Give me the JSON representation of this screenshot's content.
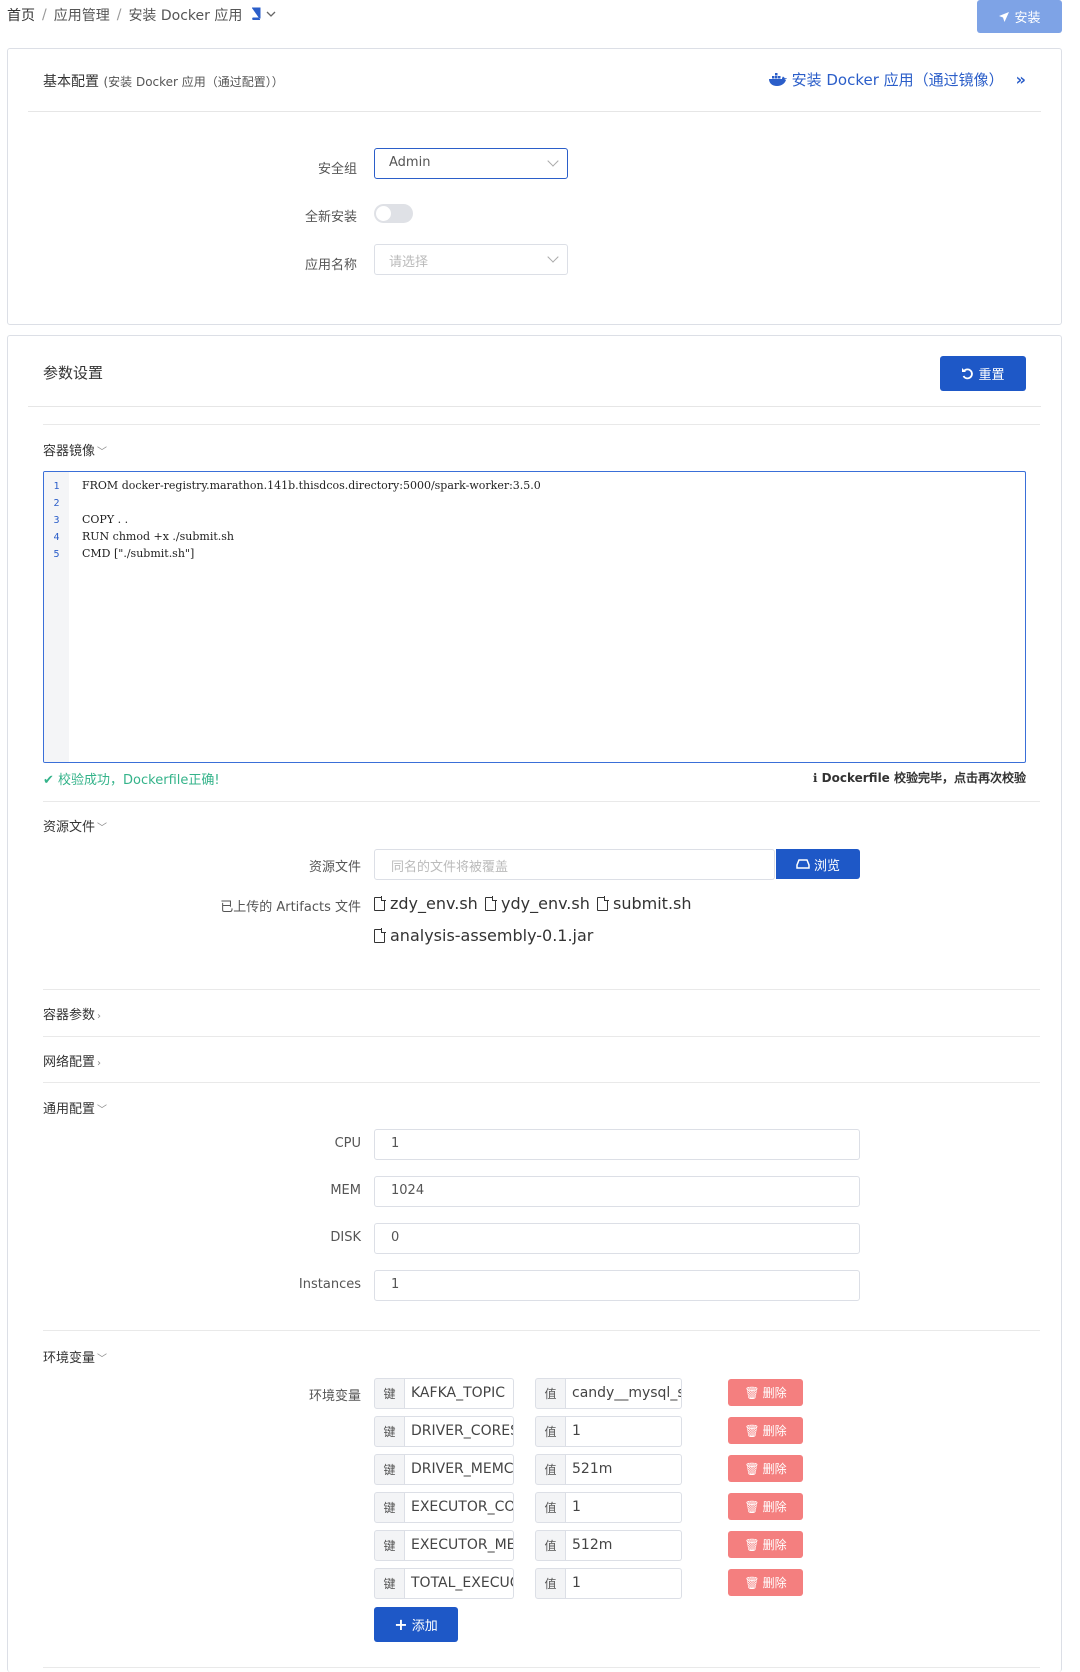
{
  "breadcrumb": {
    "home": "首页",
    "sep": "/",
    "app_mgmt": "应用管理",
    "current": "安装 Docker 应用"
  },
  "toolbar": {
    "install_label": "安装"
  },
  "basic": {
    "title": "基本配置",
    "subtitle": "(安装 Docker 应用（通过配置））",
    "switch_link": "安装 Docker 应用（通过镜像）",
    "security_group_label": "安全组",
    "security_group_value": "Admin",
    "fresh_install_label": "全新安装",
    "app_name_label": "应用名称",
    "app_name_placeholder": "请选择"
  },
  "params": {
    "title": "参数设置",
    "reset_label": "重置",
    "image_section": "容器镜像",
    "code_lines": [
      {
        "n": "1",
        "text": "FROM docker-registry.marathon.141b.thisdcos.directory:5000/spark-worker:3.5.0"
      },
      {
        "n": "2",
        "text": ""
      },
      {
        "n": "3",
        "text": "COPY . ."
      },
      {
        "n": "4",
        "text": "RUN chmod +x ./submit.sh"
      },
      {
        "n": "5",
        "text": "CMD [\"./submit.sh\"]"
      }
    ],
    "valid_msg": "校验成功，Dockerfile正确!",
    "valid_info": "Dockerfile 校验完毕，点击再次校验",
    "resource_section": "资源文件",
    "resource_file_label": "资源文件",
    "resource_file_placeholder": "同名的文件将被覆盖",
    "browse_label": "浏览",
    "artifacts_label": "已上传的 Artifacts 文件",
    "artifacts": [
      "zdy_env.sh",
      "ydy_env.sh",
      "submit.sh",
      "analysis-assembly-0.1.jar"
    ],
    "container_params_section": "容器参数",
    "network_section": "网络配置",
    "general_section": "通用配置",
    "cpu_label": "CPU",
    "cpu_value": "1",
    "mem_label": "MEM",
    "mem_value": "1024",
    "disk_label": "DISK",
    "disk_value": "0",
    "instances_label": "Instances",
    "instances_value": "1",
    "env_section": "环境变量",
    "env_label": "环境变量",
    "key_addon": "键",
    "value_addon": "值",
    "delete_label": "删除",
    "add_label": "添加",
    "env": [
      {
        "key": "KAFKA_TOPIC",
        "value": "candy__mysql_s"
      },
      {
        "key": "DRIVER_CORES",
        "value": "1"
      },
      {
        "key": "DRIVER_MEMC",
        "value": "521m"
      },
      {
        "key": "EXECUTOR_CO",
        "value": "1"
      },
      {
        "key": "EXECUTOR_ME",
        "value": "512m"
      },
      {
        "key": "TOTAL_EXECUC",
        "value": "1"
      }
    ]
  },
  "colors": {
    "primary": "#1e58c7",
    "install_btn": "#7ea3e6",
    "danger": "#f47f7f",
    "success": "#34b38a"
  }
}
